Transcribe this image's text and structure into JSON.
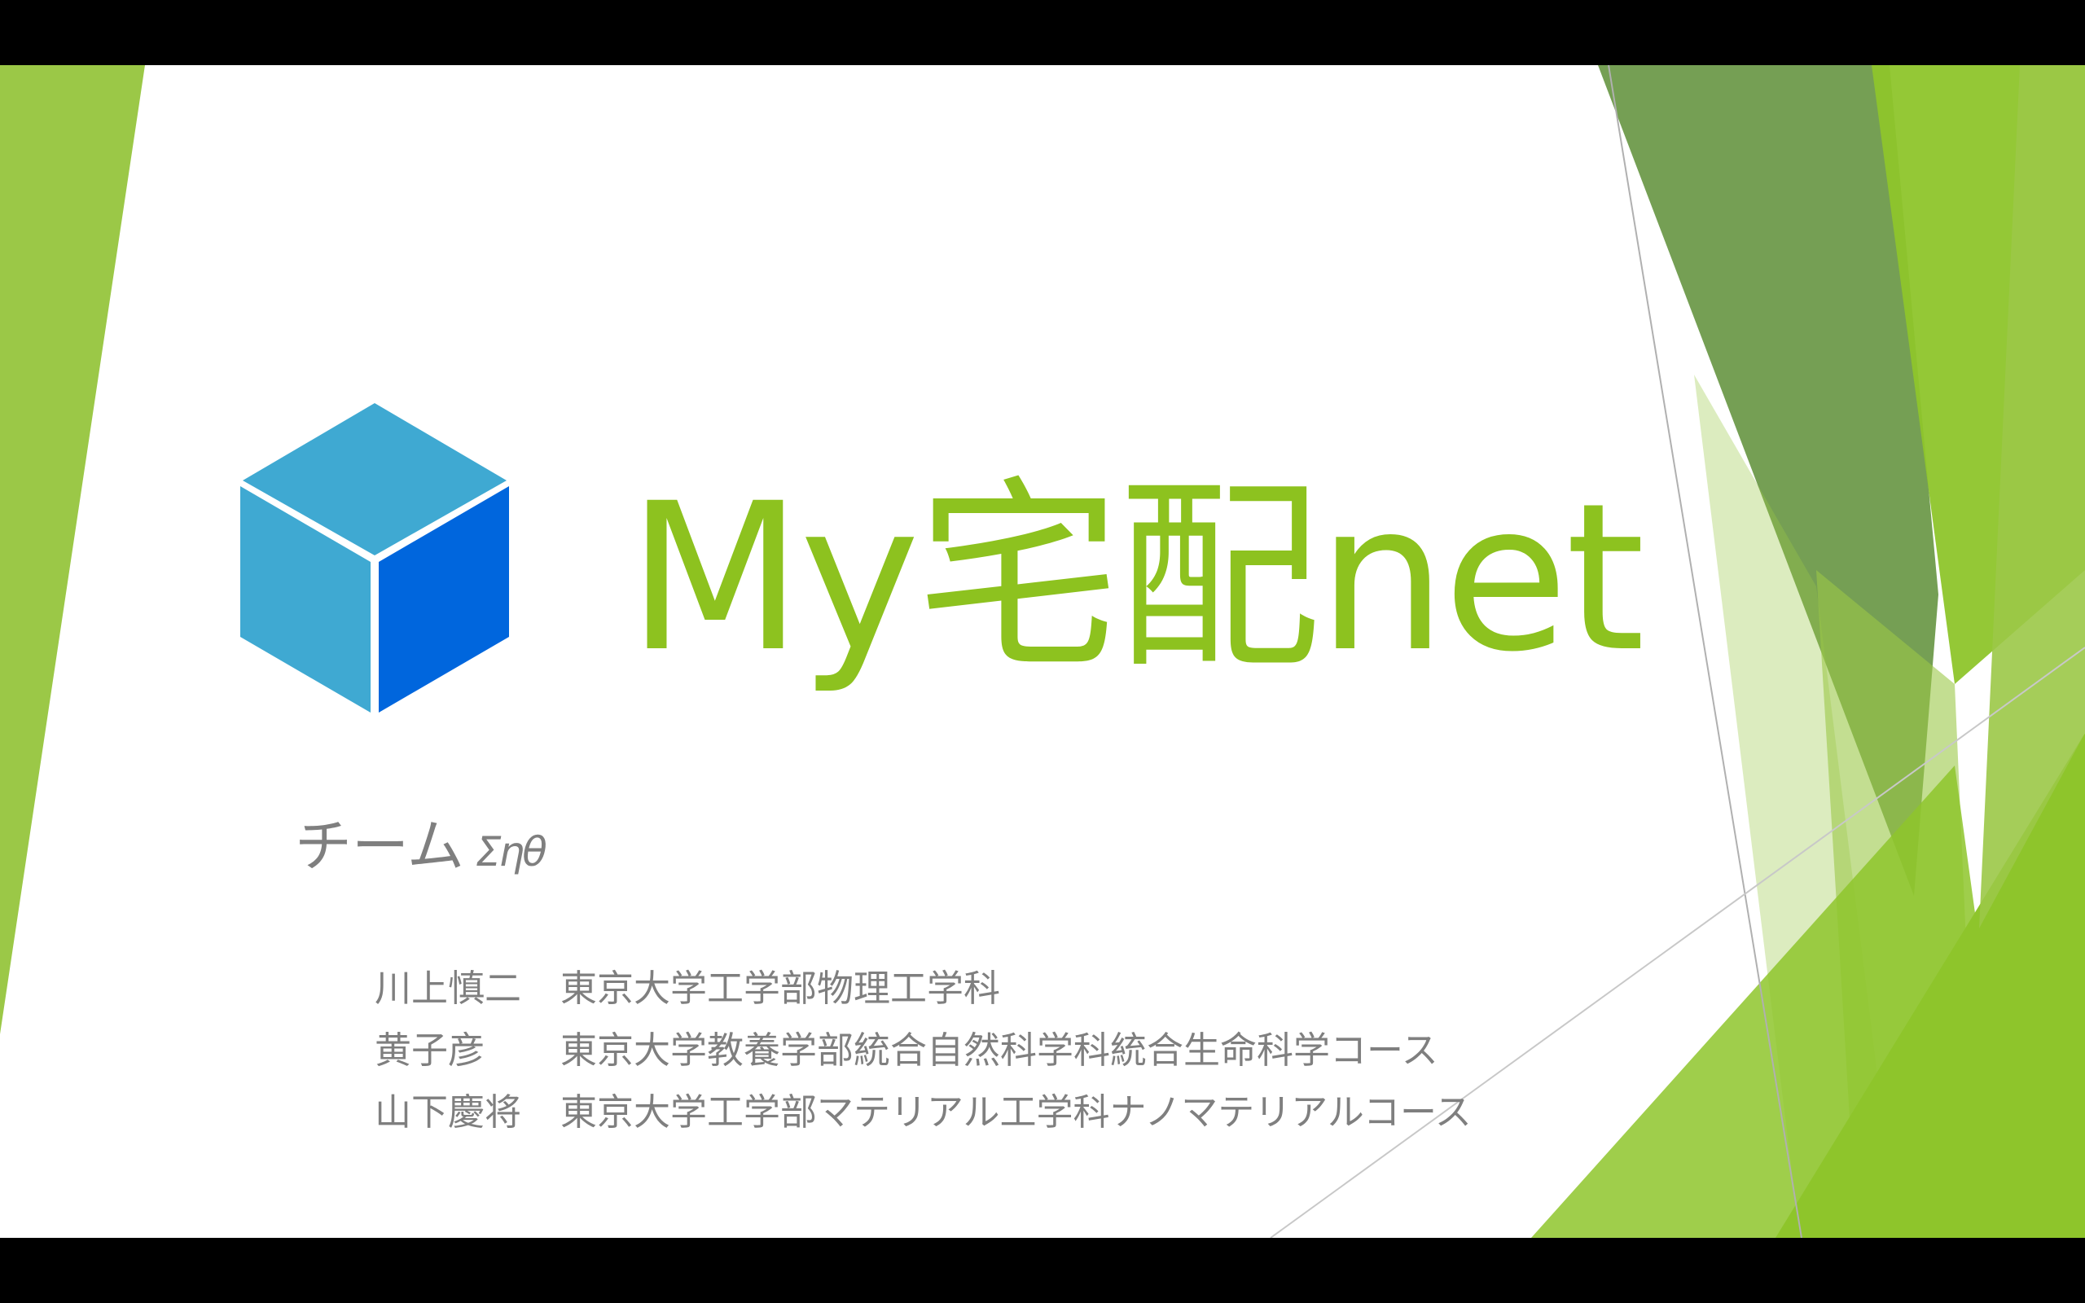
{
  "colors": {
    "title": "#8dc21f",
    "text": "#7f7f7f",
    "cube_left": "#3fa9d2",
    "cube_top": "#3fa9d2",
    "cube_right": "#0066dd",
    "green_light": "#9bc847",
    "green_dark": "#6e9a4b",
    "green_bright": "#8ec52b"
  },
  "logo": {
    "icon": "cube-icon"
  },
  "title": "My宅配net",
  "team": {
    "label": "チーム",
    "name": "Σηθ"
  },
  "members": [
    {
      "name": "川上慎二",
      "affiliation": "東京大学工学部物理工学科"
    },
    {
      "name": "黄子彦",
      "affiliation": "東京大学教養学部統合自然科学科統合生命科学コース"
    },
    {
      "name": "山下慶将",
      "affiliation": "東京大学工学部マテリアル工学科ナノマテリアルコース"
    }
  ]
}
